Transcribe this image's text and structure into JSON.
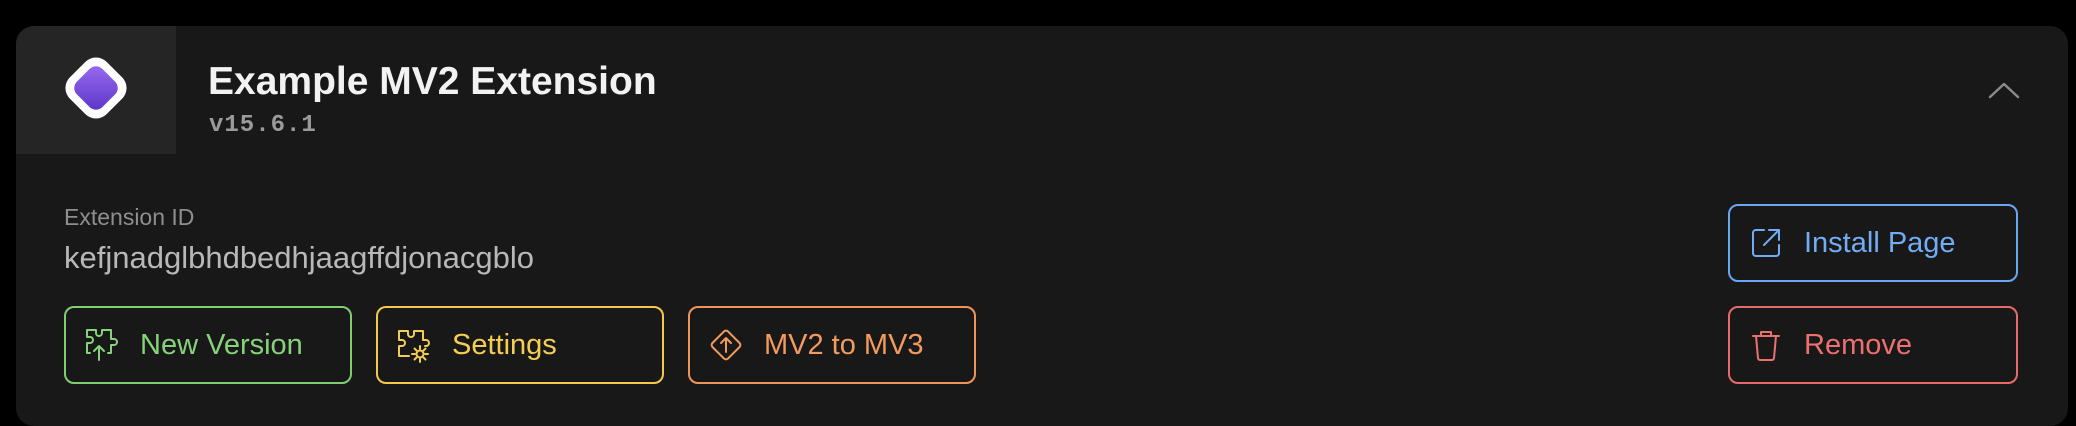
{
  "extension": {
    "name": "Example MV2 Extension",
    "version": "v15.6.1",
    "id_label": "Extension ID",
    "id_value": "kefjnadglbhdbedhjaagffdjonacgblo"
  },
  "actions": {
    "new_version": "New Version",
    "settings": "Settings",
    "migrate": "MV2 to MV3",
    "install_page": "Install Page",
    "remove": "Remove"
  },
  "icons": {
    "logo": "extension-logo-icon",
    "collapse": "chevron-up-icon",
    "new_version": "upload-puzzle-icon",
    "settings": "puzzle-gear-icon",
    "migrate": "diamond-arrow-up-icon",
    "install_page": "external-link-icon",
    "remove": "trash-icon"
  },
  "colors": {
    "green": "#86d27a",
    "yellow": "#f4cd54",
    "orange": "#f39a5e",
    "blue": "#72acf4",
    "red": "#ec7070",
    "logo_purple": "#7a4fe0"
  }
}
